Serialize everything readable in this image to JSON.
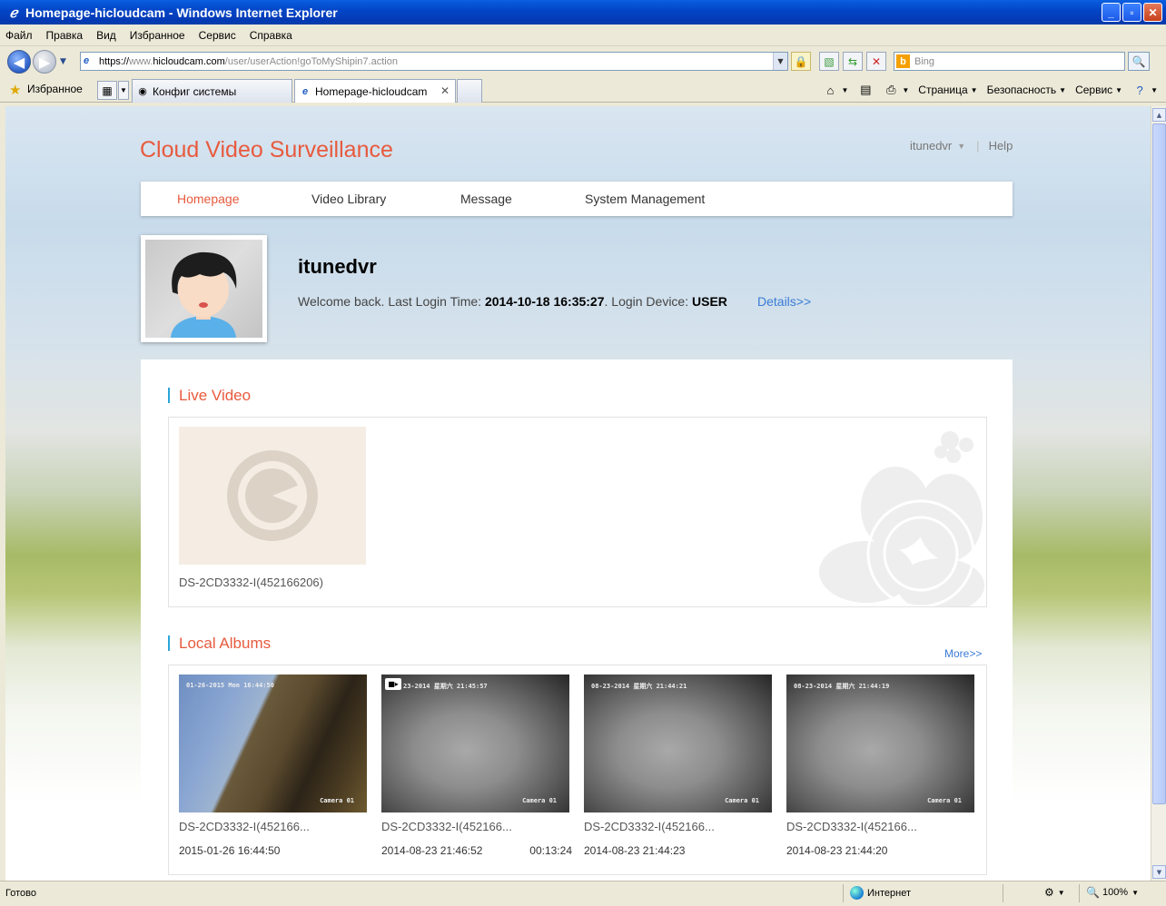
{
  "window": {
    "title": "Homepage-hicloudcam - Windows Internet Explorer",
    "buttons": {
      "minimize": "_",
      "maximize": "▫",
      "close": "✕"
    }
  },
  "menu": [
    "Файл",
    "Правка",
    "Вид",
    "Избранное",
    "Сервис",
    "Справка"
  ],
  "address": {
    "url_prefix": "https://",
    "url_mid": "www.",
    "url_host": "hicloudcam.com",
    "url_path": "/user/userAction!goToMyShipin7.action",
    "search_placeholder": "Bing"
  },
  "favorites": {
    "label": "Избранное",
    "tabs": [
      {
        "title": "Конфиг системы",
        "active": false
      },
      {
        "title": "Homepage-hicloudcam",
        "active": true
      }
    ],
    "commands": [
      "Страница",
      "Безопасность",
      "Сервис"
    ]
  },
  "site": {
    "brand": "Cloud Video Surveillance",
    "user": "itunedvr",
    "separator": "|",
    "help": "Help",
    "nav": [
      "Homepage",
      "Video Library",
      "Message",
      "System Management"
    ],
    "active_nav": "Homepage"
  },
  "profile": {
    "name": "itunedvr",
    "welcome_prefix": "Welcome back. Last Login Time: ",
    "last_login": "2014-10-18 16:35:27",
    "device_prefix": ". Login Device: ",
    "device": "USER",
    "details": "Details>>"
  },
  "live_video": {
    "title": "Live Video",
    "camera": "DS-2CD3332-I(452166206)"
  },
  "albums": {
    "title": "Local Albums",
    "more": "More>>",
    "items": [
      {
        "name": "DS-2CD3332-I(452166...",
        "date": "2015-01-26 16:44:50",
        "duration": "",
        "overlay": "01-26-2015 Mon 16:44:50",
        "camera_label": "Camera 01",
        "is_video": false
      },
      {
        "name": "DS-2CD3332-I(452166...",
        "date": "2014-08-23 21:46:52",
        "duration": "00:13:24",
        "overlay": "23-2014 星期六 21:45:57",
        "camera_label": "Camera 01",
        "is_video": true
      },
      {
        "name": "DS-2CD3332-I(452166...",
        "date": "2014-08-23 21:44:23",
        "duration": "",
        "overlay": "08-23-2014 星期六 21:44:21",
        "camera_label": "Camera 01",
        "is_video": false
      },
      {
        "name": "DS-2CD3332-I(452166...",
        "date": "2014-08-23 21:44:20",
        "duration": "",
        "overlay": "08-23-2014 星期六 21:44:19",
        "camera_label": "Camera 01",
        "is_video": false
      }
    ]
  },
  "status": {
    "text": "Готово",
    "zone": "Интернет",
    "zoom": "100%"
  },
  "colors": {
    "brand": "#e85a3e",
    "link": "#3a7bd5",
    "section_accent": "#2aa5d8"
  }
}
